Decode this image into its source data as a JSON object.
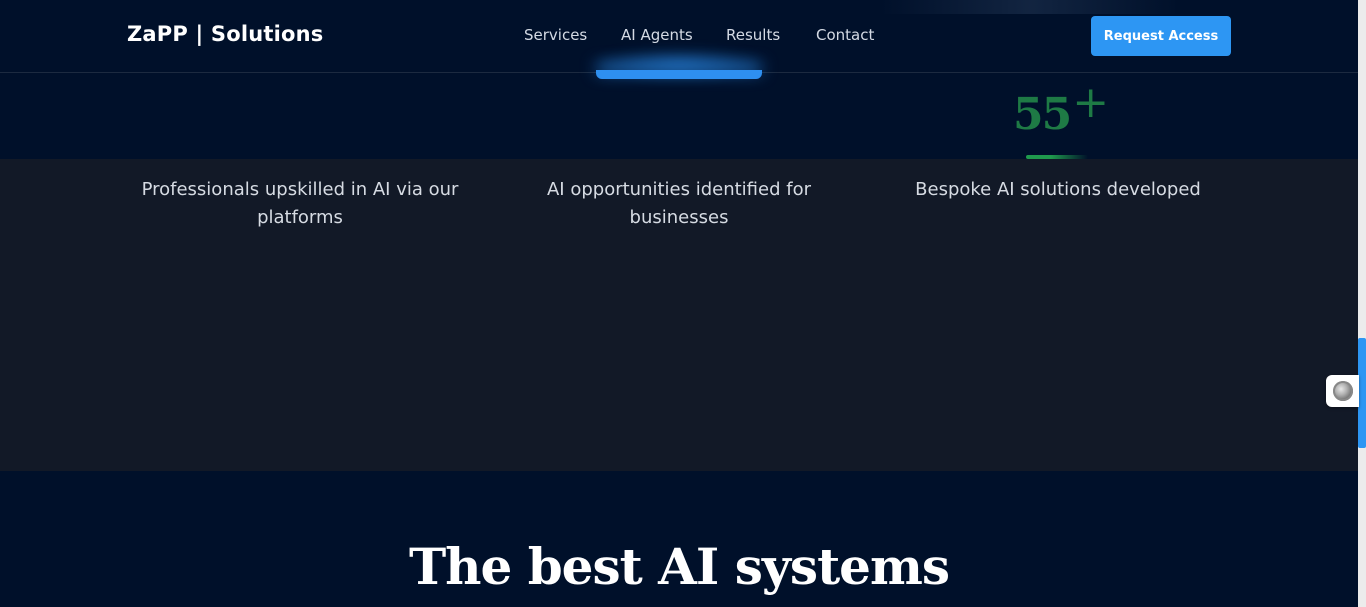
{
  "header": {
    "logo": "ZaPP | Solutions",
    "nav": [
      {
        "label": "Services"
      },
      {
        "label": "AI Agents"
      },
      {
        "label": "Results"
      },
      {
        "label": "Contact"
      }
    ],
    "active_nav": "AI Agents",
    "cta_label": "Request Access"
  },
  "stats": {
    "items": [
      {
        "label": "Professionals upskilled in AI via our platforms"
      },
      {
        "label": "AI opportunities identified for businesses"
      },
      {
        "value": "55",
        "suffix": "+",
        "label": "Bespoke AI solutions developed"
      }
    ]
  },
  "section": {
    "heading": "The best AI systems"
  },
  "side_widget": {
    "icon": "circle-badge-icon"
  },
  "colors": {
    "background": "#00102a",
    "stats_band": "#121927",
    "accent": "#2d96f3",
    "stat_number": "#1e7a45"
  }
}
